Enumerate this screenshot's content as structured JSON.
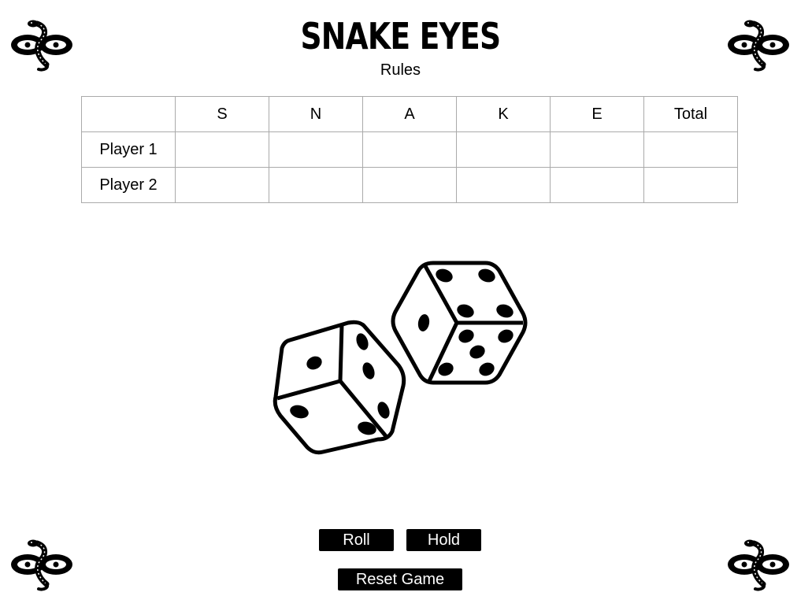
{
  "header": {
    "title": "SNAKE EYES",
    "rules_link": "Rules"
  },
  "scoreboard": {
    "columns": [
      "",
      "S",
      "N",
      "A",
      "K",
      "E",
      "Total"
    ],
    "rows": [
      {
        "player": "Player 1",
        "cells": [
          "",
          "",
          "",
          "",
          "",
          ""
        ]
      },
      {
        "player": "Player 2",
        "cells": [
          "",
          "",
          "",
          "",
          "",
          ""
        ]
      }
    ]
  },
  "dice": {
    "icon": "dice-pair-icon",
    "left_die_visible_faces": [
      2,
      3,
      2
    ],
    "right_die_visible_faces": [
      4,
      1,
      5
    ]
  },
  "controls": {
    "roll_label": "Roll",
    "hold_label": "Hold",
    "reset_label": "Reset Game"
  },
  "decor": {
    "corner_icon": "snake-logo-icon"
  },
  "colors": {
    "background": "#ffffff",
    "foreground": "#000000",
    "grid": "#aaaaaa"
  }
}
